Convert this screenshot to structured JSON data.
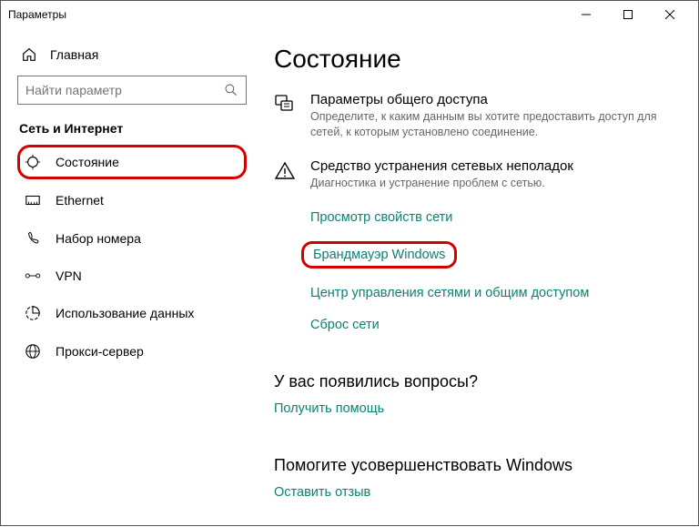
{
  "window": {
    "title": "Параметры"
  },
  "sidebar": {
    "home_label": "Главная",
    "search_placeholder": "Найти параметр",
    "section_label": "Сеть и Интернет",
    "items": [
      {
        "label": "Состояние"
      },
      {
        "label": "Ethernet"
      },
      {
        "label": "Набор номера"
      },
      {
        "label": "VPN"
      },
      {
        "label": "Использование данных"
      },
      {
        "label": "Прокси-сервер"
      }
    ]
  },
  "main": {
    "title": "Состояние",
    "sharing": {
      "title": "Параметры общего доступа",
      "desc": "Определите, к каким данным вы хотите предоставить доступ для сетей, к которым установлено соединение."
    },
    "troubleshoot": {
      "title": "Средство устранения сетевых неполадок",
      "desc": "Диагностика и устранение проблем с сетью."
    },
    "links": {
      "view_props": "Просмотр свойств сети",
      "firewall": "Брандмауэр Windows",
      "sharing_center": "Центр управления сетями и общим доступом",
      "reset": "Сброс сети"
    },
    "questions": {
      "title": "У вас появились вопросы?",
      "link": "Получить помощь"
    },
    "improve": {
      "title": "Помогите усовершенствовать Windows",
      "link": "Оставить отзыв"
    }
  }
}
